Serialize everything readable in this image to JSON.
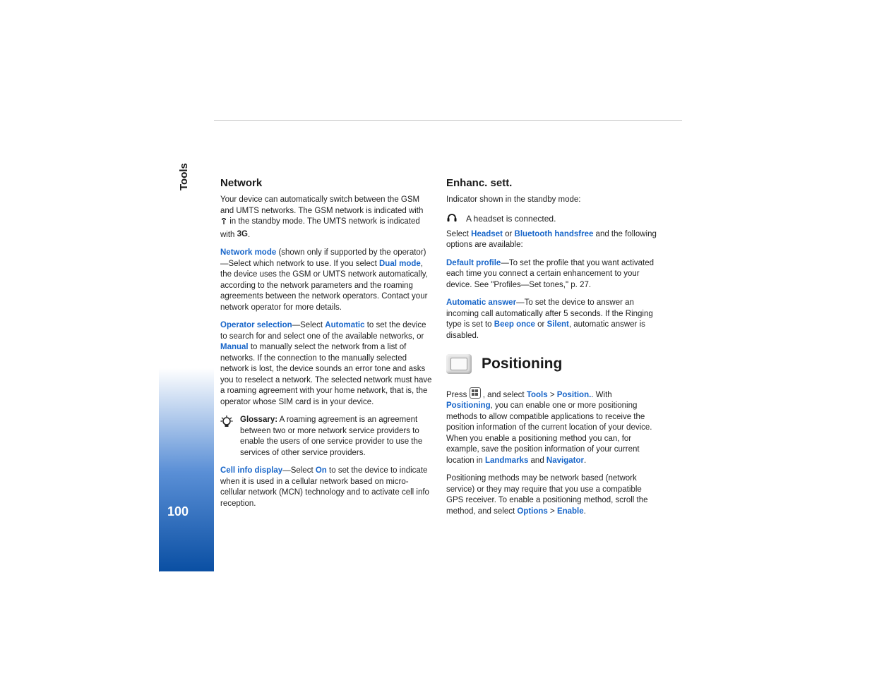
{
  "side_label": "Tools",
  "page_number": "100",
  "left": {
    "h_network": "Network",
    "p1_a": "Your device can automatically switch between the GSM and UMTS networks. The GSM network is indicated with ",
    "p1_b": " in the standby mode. The UMTS network is indicated with ",
    "p1_3g": "3G",
    "p1_c": ".",
    "p2_label": "Network mode",
    "p2_a": " (shown only if supported by the operator)—Select which network to use. If you select ",
    "p2_dual": "Dual mode",
    "p2_b": ", the device uses the GSM or UMTS network automatically, according to the network parameters and the roaming agreements between the network operators. Contact your network operator for more details.",
    "p3_label": "Operator selection",
    "p3_a": "—Select ",
    "p3_auto": "Automatic",
    "p3_b": " to set the device to search for and select one of the available networks, or ",
    "p3_manual": "Manual",
    "p3_c": " to manually select the network from a list of networks. If the connection to the manually selected network is lost, the device sounds an error tone and asks you to reselect a network. The selected network must have a roaming agreement with your home network, that is, the operator whose SIM card is in your device.",
    "gloss_label": "Glossary:",
    "gloss_text": " A roaming agreement is an agreement between two or more network service providers to enable the users of one service provider to use the services of other service providers.",
    "p4_label": "Cell info display",
    "p4_a": "—Select ",
    "p4_on": "On",
    "p4_b": " to set the device to indicate when it is used in a cellular network based on micro-cellular network (MCN) technology and to activate cell info reception."
  },
  "right": {
    "h_enh": "Enhanc. sett.",
    "p1": "Indicator shown in the standby mode:",
    "ind_headset": "A headset is connected.",
    "p2_a": "Select ",
    "p2_headset": "Headset",
    "p2_or": " or ",
    "p2_bt": "Bluetooth handsfree",
    "p2_b": " and the following options are available:",
    "p3_label": "Default profile",
    "p3_a": "—To set the profile that you want activated each time you connect a certain enhancement to your device. See \"Profiles—Set tones,\" p. 27.",
    "p4_label": "Automatic answer",
    "p4_a": "—To set the device to answer an incoming call automatically after 5 seconds. If the Ringing type is set to ",
    "p4_beep": "Beep once",
    "p4_or": " or ",
    "p4_silent": "Silent",
    "p4_b": ", automatic answer is disabled.",
    "h_pos": "Positioning",
    "p5_a": "Press ",
    "p5_b": " , and select ",
    "p5_tools": "Tools",
    "p5_gt1": " > ",
    "p5_position": "Position.",
    "p5_c": ". With ",
    "p5_positioning": "Positioning",
    "p5_d": ", you can enable one or more positioning methods to allow compatible applications to receive the position information of the current location of your device. When you enable a positioning method you can, for example, save the position information of your current location in ",
    "p5_land": "Landmarks",
    "p5_and": " and ",
    "p5_nav": "Navigator",
    "p5_e": ".",
    "p6_a": "Positioning methods may be network based (network service) or they may require that you use a compatible GPS receiver. To enable a positioning method, scroll the method, and select ",
    "p6_opts": "Options",
    "p6_gt": " > ",
    "p6_enable": "Enable",
    "p6_b": "."
  }
}
